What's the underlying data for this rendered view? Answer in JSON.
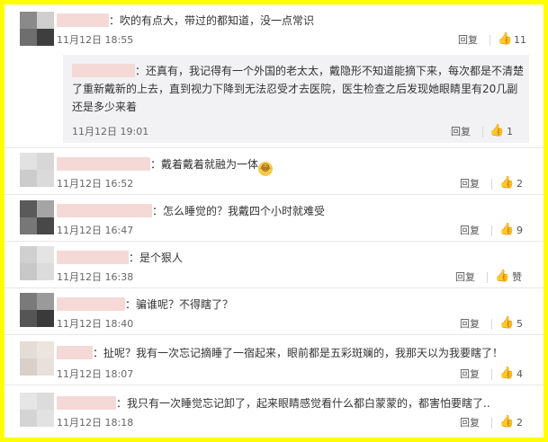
{
  "ui": {
    "reply_label": "回复",
    "like_icon": "thumbs-up-icon"
  },
  "colors": {
    "border": "#ffff00",
    "username_blur": "#f4d9d6",
    "quote_bg": "#f2f2f5"
  },
  "comments": [
    {
      "text": "：吹的有点大，带过的都知道，没一点常识",
      "date": "11月12日",
      "time": "18:55",
      "likes": "11"
    },
    {
      "text": "：戴着戴着就融为一体",
      "date": "11月12日",
      "time": "16:52",
      "likes": "2"
    },
    {
      "text": "：怎么睡觉的？我戴四个小时就难受",
      "date": "11月12日",
      "time": "16:47",
      "likes": "9"
    },
    {
      "text": "：是个狠人",
      "date": "11月12日",
      "time": "16:38",
      "likes": "赞"
    },
    {
      "text": "：骗谁呢？不得瞎了？",
      "date": "11月12日",
      "time": "18:40",
      "likes": "5"
    },
    {
      "text": "：扯呢？我有一次忘记摘睡了一宿起来，眼前都是五彩斑斓的，我那天以为我要瞎了！",
      "date": "11月12日",
      "time": "18:07",
      "likes": "4"
    },
    {
      "text": "：我只有一次睡觉忘记卸了，起来眼睛感觉看什么都白蒙蒙的，都害怕要瞎了..",
      "date": "11月12日",
      "time": "18:18",
      "likes": "2"
    }
  ],
  "quote": {
    "text": "：还真有，我记得有一个外国的老太太，戴隐形不知道能摘下来，每次都是不清楚了重新戴新的上去，直到视力下降到无法忍受才去医院，医生检查之后发现她眼睛里有20几副还是多少来着",
    "date": "11月12日",
    "time": "19:01",
    "likes": "1"
  }
}
